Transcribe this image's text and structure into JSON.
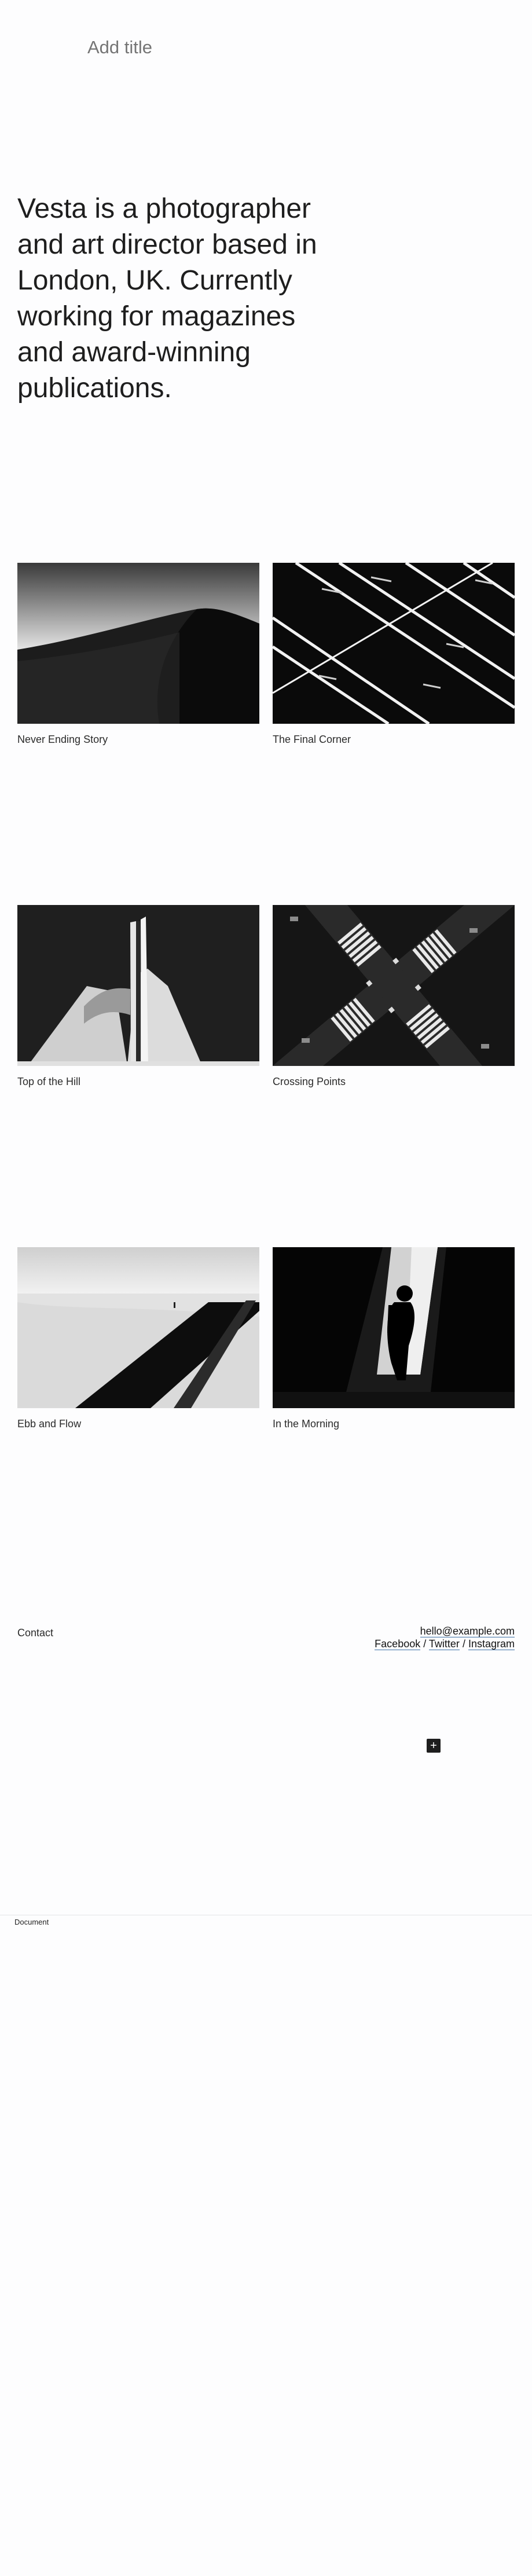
{
  "header": {
    "title_placeholder": "Add title"
  },
  "intro": {
    "text": "Vesta is a photographer and art director based in London, UK. Currently working for magazines and award-winning publications."
  },
  "gallery": [
    {
      "caption": "Never Ending Story"
    },
    {
      "caption": "The Final Corner"
    },
    {
      "caption": "Top of the Hill"
    },
    {
      "caption": "Crossing Points"
    },
    {
      "caption": "Ebb and Flow"
    },
    {
      "caption": "In the Morning"
    }
  ],
  "contact": {
    "label": "Contact",
    "email": "hello@example.com",
    "facebook": "Facebook",
    "twitter": "Twitter",
    "instagram": "Instagram",
    "separator": " / "
  },
  "editor": {
    "add_block_icon": "plus-icon",
    "breadcrumb": "Document"
  },
  "colors": {
    "text": "#1e1e1e",
    "placeholder": "#757575",
    "link_underline": "#3a6ea5",
    "background": "#fdfdfe"
  }
}
